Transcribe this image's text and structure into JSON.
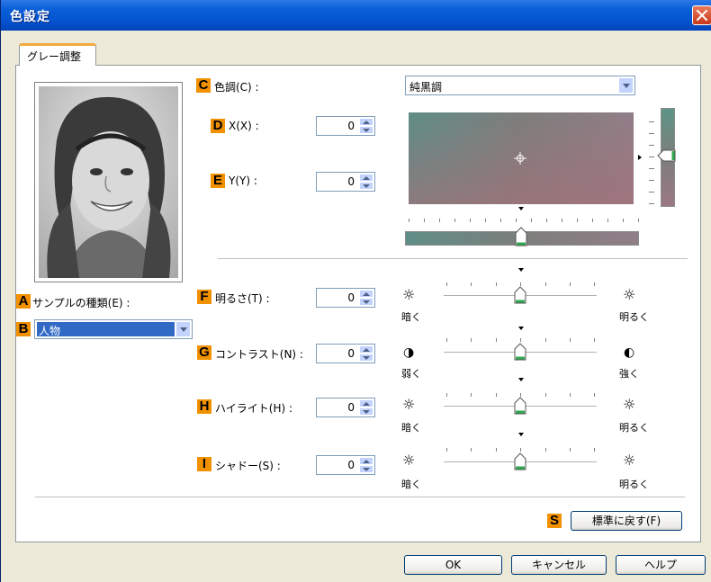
{
  "window": {
    "title": "色設定"
  },
  "tab": {
    "label": "グレー調整"
  },
  "sample": {
    "letter_a": "A",
    "type_label": "サンプルの種類(E) :",
    "letter_b": "B",
    "selected": "人物"
  },
  "tone": {
    "letter_c": "C",
    "label": "色調(C) :",
    "selected": "純黒調",
    "letter_d": "D",
    "x_label": "X(X) :",
    "x_value": "0",
    "letter_e": "E",
    "y_label": "Y(Y) :",
    "y_value": "0"
  },
  "brightness": {
    "letter": "F",
    "label": "明るさ(T) :",
    "value": "0",
    "low_label": "暗く",
    "high_label": "明るく"
  },
  "contrast": {
    "letter": "G",
    "label": "コントラスト(N) :",
    "value": "0",
    "low_label": "弱く",
    "high_label": "強く"
  },
  "highlight": {
    "letter": "H",
    "label": "ハイライト(H) :",
    "value": "0",
    "low_label": "暗く",
    "high_label": "明るく"
  },
  "shadow": {
    "letter": "I",
    "label": "シャドー(S) :",
    "value": "0",
    "low_label": "暗く",
    "high_label": "明るく"
  },
  "reset": {
    "letter": "S",
    "label": "標準に戻す(F)"
  },
  "footer": {
    "ok_label": "OK",
    "cancel_label": "キャンセル",
    "help_label": "ヘルプ"
  },
  "colors": {
    "accent_letter": "#F29100",
    "titlebar": "#0553D0",
    "selection": "#316AC5"
  }
}
